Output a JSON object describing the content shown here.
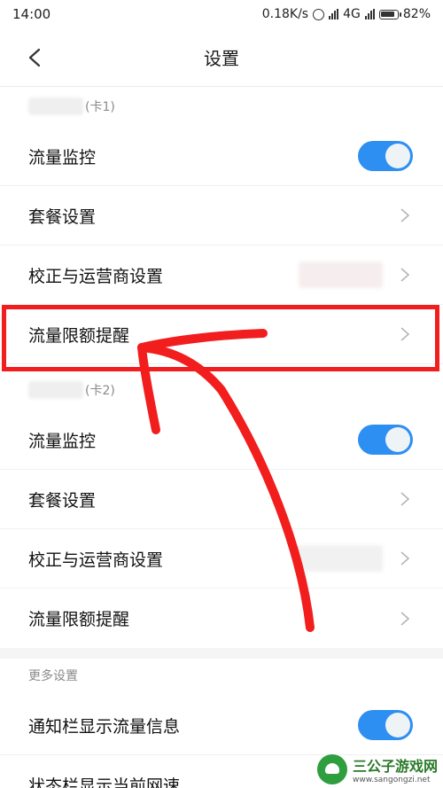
{
  "status_bar": {
    "time": "14:00",
    "speed": "0.18K/s",
    "network": "4G",
    "battery": "82%"
  },
  "header": {
    "title": "设置"
  },
  "sim1": {
    "label": "(卡1)",
    "items": [
      {
        "label": "流量监控",
        "type": "toggle",
        "on": true
      },
      {
        "label": "套餐设置",
        "type": "chevron"
      },
      {
        "label": "校正与运营商设置",
        "type": "chevron"
      },
      {
        "label": "流量限额提醒",
        "type": "chevron"
      }
    ]
  },
  "sim2": {
    "label": "(卡2)",
    "items": [
      {
        "label": "流量监控",
        "type": "toggle",
        "on": true
      },
      {
        "label": "套餐设置",
        "type": "chevron"
      },
      {
        "label": "校正与运营商设置",
        "type": "chevron"
      },
      {
        "label": "流量限额提醒",
        "type": "chevron"
      }
    ]
  },
  "more": {
    "label": "更多设置",
    "items": [
      {
        "label": "通知栏显示流量信息",
        "type": "toggle",
        "on": true
      },
      {
        "label": "状态栏显示当前网速",
        "type": "toggle"
      }
    ]
  },
  "colors": {
    "toggle_on": "#2e8ff2",
    "annotation_red": "#f21d1d"
  },
  "watermark": {
    "title": "三公子游戏网",
    "url": "www.sangongzi.net"
  }
}
